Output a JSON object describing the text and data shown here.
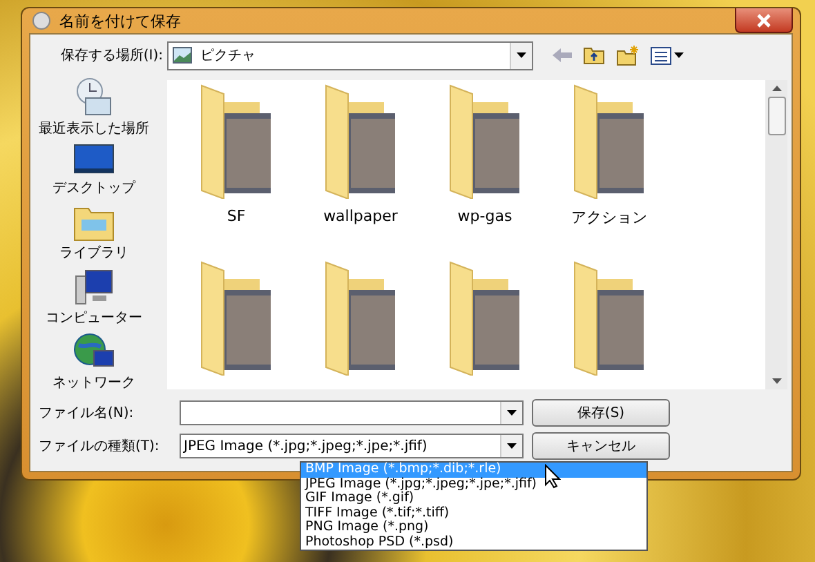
{
  "window": {
    "title": "名前を付けて保存"
  },
  "location": {
    "label": "保存する場所(I):",
    "value": "ピクチャ"
  },
  "places": [
    {
      "kind": "recent",
      "label": "最近表示した場所"
    },
    {
      "kind": "desktop",
      "label": "デスクトップ"
    },
    {
      "kind": "library",
      "label": "ライブラリ"
    },
    {
      "kind": "computer",
      "label": "コンピューター"
    },
    {
      "kind": "network",
      "label": "ネットワーク"
    }
  ],
  "folders": [
    {
      "kind": "folder",
      "name": "SF"
    },
    {
      "kind": "folder",
      "name": "wallpaper"
    },
    {
      "kind": "folder",
      "name": "wp-gas"
    },
    {
      "kind": "folder",
      "name": "アクション"
    },
    {
      "kind": "folder"
    },
    {
      "kind": "folder"
    },
    {
      "kind": "folder"
    },
    {
      "kind": "folder"
    }
  ],
  "file_name": {
    "label": "ファイル名(N):"
  },
  "file_type": {
    "label": "ファイルの種類(T):",
    "value": "JPEG Image (*.jpg;*.jpeg;*.jpe;*.jfif)"
  },
  "file_type_options": [
    {
      "label": "BMP Image (*.bmp;*.dib;*.rle)",
      "selected": true
    },
    {
      "label": "JPEG Image (*.jpg;*.jpeg;*.jpe;*.jfif)",
      "selected": false
    },
    {
      "label": "GIF Image (*.gif)",
      "selected": false
    },
    {
      "label": "TIFF Image (*.tif;*.tiff)",
      "selected": false
    },
    {
      "label": "PNG Image (*.png)",
      "selected": false
    },
    {
      "label": "Photoshop PSD (*.psd)",
      "selected": false
    }
  ],
  "buttons": [
    "保存(S)",
    "キャンセル"
  ]
}
